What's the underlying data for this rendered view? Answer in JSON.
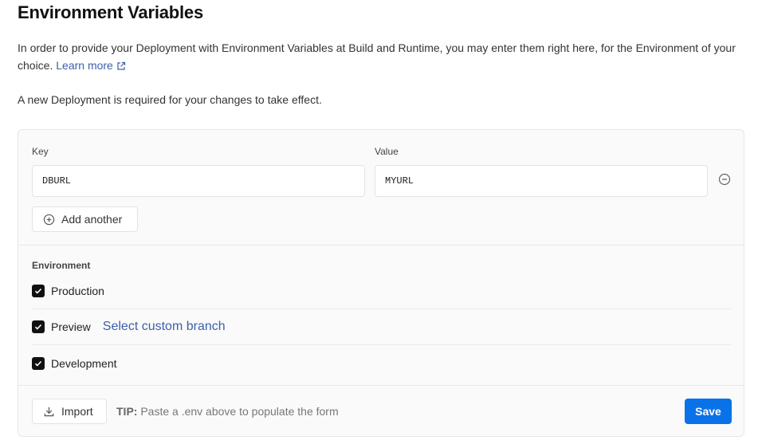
{
  "page": {
    "title": "Environment Variables",
    "description": "In order to provide your Deployment with Environment Variables at Build and Runtime, you may enter them right here, for the Environment of your choice.",
    "learn_more": "Learn more",
    "note": "A new Deployment is required for your changes to take effect."
  },
  "variables": {
    "key_label": "Key",
    "value_label": "Value",
    "key_value": "DBURL",
    "value_value": "MYURL",
    "add_another": "Add another"
  },
  "environment": {
    "title": "Environment",
    "options": [
      {
        "label": "Production",
        "checked": true
      },
      {
        "label": "Preview",
        "checked": true
      },
      {
        "label": "Development",
        "checked": true
      }
    ],
    "custom_branch": "Select custom branch"
  },
  "footer": {
    "import": "Import",
    "tip_label": "TIP:",
    "tip_text": "Paste a .env above to populate the form",
    "save": "Save"
  },
  "colors": {
    "accent": "#0a72e8",
    "link": "#3d5fa8",
    "checkbox": "#111111"
  },
  "icons": [
    "external-link-icon",
    "minus-circle-icon",
    "plus-circle-icon",
    "check-icon",
    "download-icon"
  ]
}
